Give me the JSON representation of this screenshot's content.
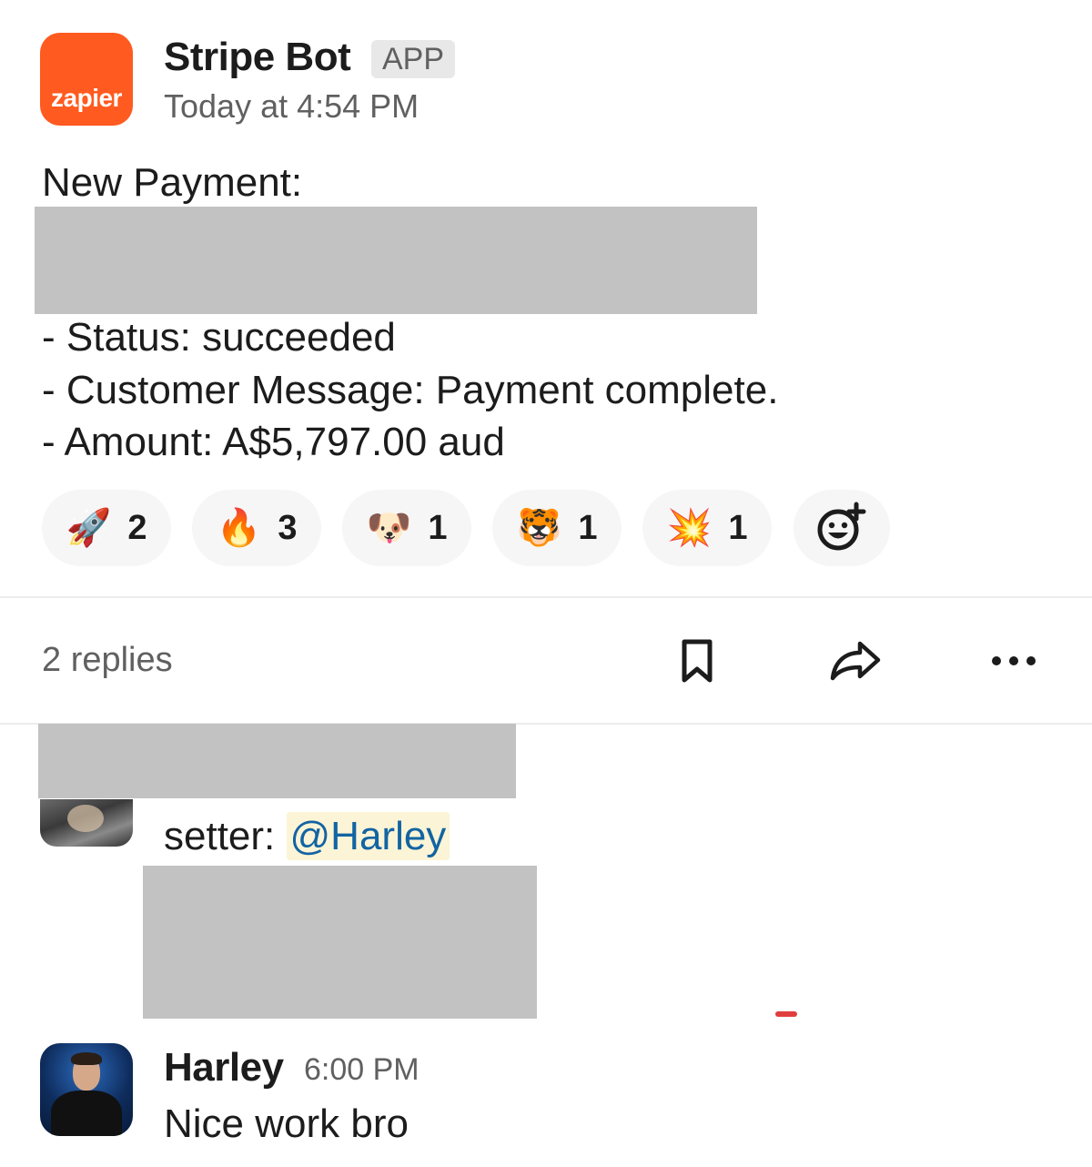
{
  "message": {
    "avatar_logo": "zapier",
    "sender": "Stripe Bot",
    "badge": "APP",
    "timestamp": "Today at 4:54 PM",
    "title": "New Payment:",
    "lines": [
      "- Status: succeeded",
      "- Customer Message: Payment complete.",
      "- Amount: A$5,797.00 aud"
    ]
  },
  "reactions": [
    {
      "emoji": "🚀",
      "icon": "rocket-icon",
      "count": "2"
    },
    {
      "emoji": "🔥",
      "icon": "fire-icon",
      "count": "3"
    },
    {
      "emoji": "🐶",
      "icon": "dog-face-icon",
      "count": "1"
    },
    {
      "emoji": "🐯",
      "icon": "tiger-face-icon",
      "count": "1"
    },
    {
      "emoji": "💥",
      "icon": "collision-icon",
      "count": "1"
    }
  ],
  "add_reaction_icon": "add-reaction-icon",
  "thread": {
    "replies_label": "2 replies",
    "actions": [
      "bookmark-icon",
      "share-icon",
      "more-icon"
    ]
  },
  "replies": [
    {
      "text_prefix": "setter: ",
      "mention": "@Harley"
    },
    {
      "name": "Harley",
      "time": "6:00 PM",
      "body": "Nice work bro"
    }
  ],
  "colors": {
    "zapier_orange": "#ff5a1f",
    "mention_bg": "#fcf4d6",
    "mention_text": "#1264a3",
    "muted_text": "#616061",
    "redaction": "#c2c2c2"
  }
}
